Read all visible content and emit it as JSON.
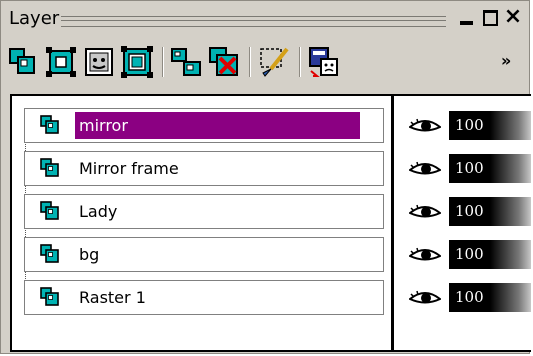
{
  "window": {
    "title": "Layer",
    "controls": {
      "minimize": "minimize",
      "maximize": "maximize",
      "close": "×"
    }
  },
  "toolbar": {
    "tools": [
      {
        "name": "new-raster-layer",
        "icon": "new-raster-layer-icon"
      },
      {
        "name": "new-vector-layer",
        "icon": "new-vector-layer-icon"
      },
      {
        "name": "new-mask-layer",
        "icon": "new-mask-layer-icon"
      },
      {
        "name": "new-adjustment-layer",
        "icon": "new-adjustment-layer-icon"
      },
      {
        "name": "duplicate-layer",
        "icon": "duplicate-layer-icon"
      },
      {
        "name": "delete-layer",
        "icon": "delete-layer-icon"
      },
      {
        "name": "edit-selection",
        "icon": "paintbrush-selection-icon"
      },
      {
        "name": "layer-properties",
        "icon": "layer-properties-icon"
      }
    ],
    "overflow": "»"
  },
  "layers": [
    {
      "name": "mirror",
      "selected": true,
      "visible": true,
      "opacity": "100"
    },
    {
      "name": "Mirror frame",
      "selected": false,
      "visible": true,
      "opacity": "100"
    },
    {
      "name": "Lady",
      "selected": false,
      "visible": true,
      "opacity": "100"
    },
    {
      "name": "bg",
      "selected": false,
      "visible": true,
      "opacity": "100"
    },
    {
      "name": "Raster 1",
      "selected": false,
      "visible": true,
      "opacity": "100"
    }
  ],
  "colors": {
    "selection": "#8b0082",
    "panel_bg": "#d4d0c8",
    "layer_icon": "#00b3b3"
  }
}
